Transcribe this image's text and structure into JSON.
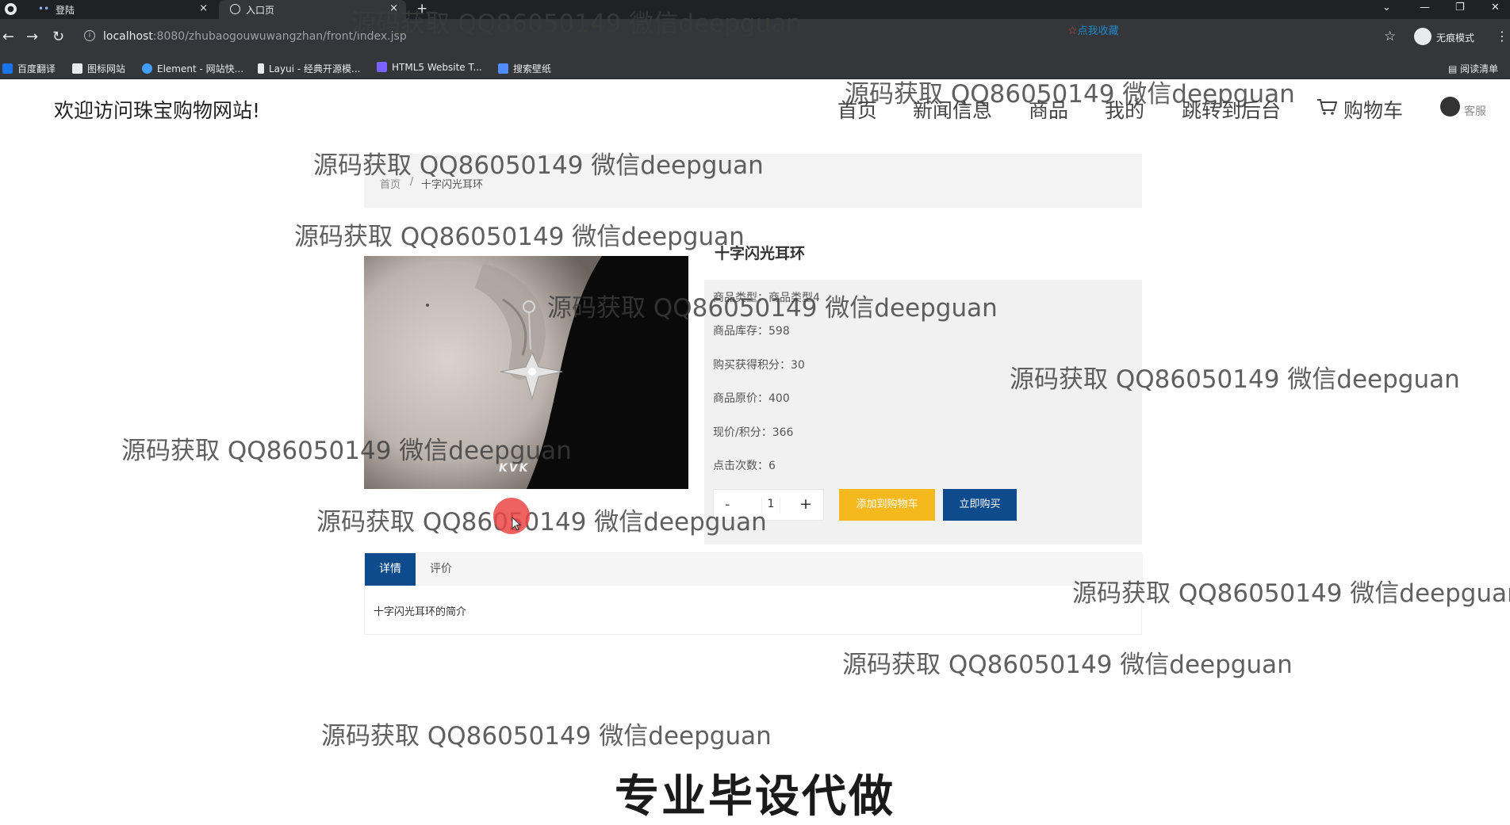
{
  "browser": {
    "tabs": [
      {
        "title": "登陆",
        "close": "×"
      },
      {
        "title": "入口页",
        "close": "×"
      }
    ],
    "new_tab": "+",
    "url_host": "localhost",
    "url_rest": ":8080/zhubaogouwuwangzhan/front/index.jsp",
    "incognito_label": "无痕模式",
    "bookmarks": [
      "百度翻译",
      "图标网站",
      "Element - 网站快...",
      "Layui - 经典开源模...",
      "HTML5 Website T...",
      "搜索壁纸"
    ],
    "reading_list": "阅读清单"
  },
  "header": {
    "welcome": "欢迎访问珠宝购物网站!",
    "nav": [
      "首页",
      "新闻信息",
      "商品",
      "我的",
      "跳转到后台",
      "购物车"
    ],
    "service": "客服"
  },
  "breadcrumb": {
    "home": "首页",
    "separator": "/",
    "current": "十字闪光耳环",
    "favorite": "点我收藏"
  },
  "product": {
    "name": "十字闪光耳环",
    "image_brand": "KVK",
    "info": [
      "商品类型：商品类型4",
      "商品库存：598",
      "购买获得积分：30",
      "商品原价：400",
      "现价/积分：366",
      "点击次数：6"
    ],
    "qty_minus": "-",
    "quantity": "1",
    "qty_plus": "+",
    "add_to_cart": "添加到购物车",
    "buy_now": "立即购买"
  },
  "tabs": {
    "detail": "详情",
    "review": "评价",
    "description": "十字闪光耳环的简介"
  },
  "watermark": "源码获取 QQ86050149 微信deepguan",
  "slogan": "专业毕设代做"
}
